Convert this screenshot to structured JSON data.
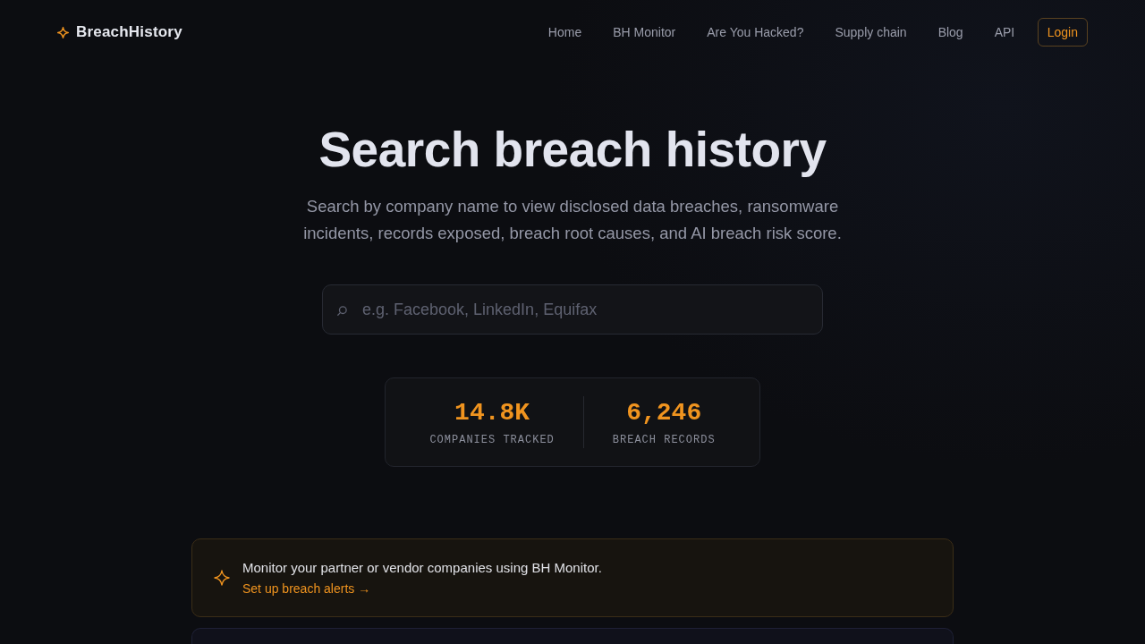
{
  "nav": {
    "logo": "BreachHistory",
    "links": [
      "Home",
      "BH Monitor",
      "Are You Hacked?",
      "Supply chain",
      "Blog",
      "API"
    ],
    "login": "Login"
  },
  "hero": {
    "title": "Search breach history",
    "subtitle": "Search by company name to view disclosed data breaches, ransomware incidents, records exposed, breach root causes, and AI breach risk score.",
    "search": {
      "placeholder": "e.g. Facebook, LinkedIn, Equifax"
    }
  },
  "stats": [
    {
      "value": "14.8K",
      "label": "COMPANIES TRACKED"
    },
    {
      "value": "6,246",
      "label": "BREACH RECORDS"
    }
  ],
  "banner": {
    "text": "Monitor your partner or vendor companies using BH Monitor.",
    "link": "Set up breach alerts →"
  }
}
